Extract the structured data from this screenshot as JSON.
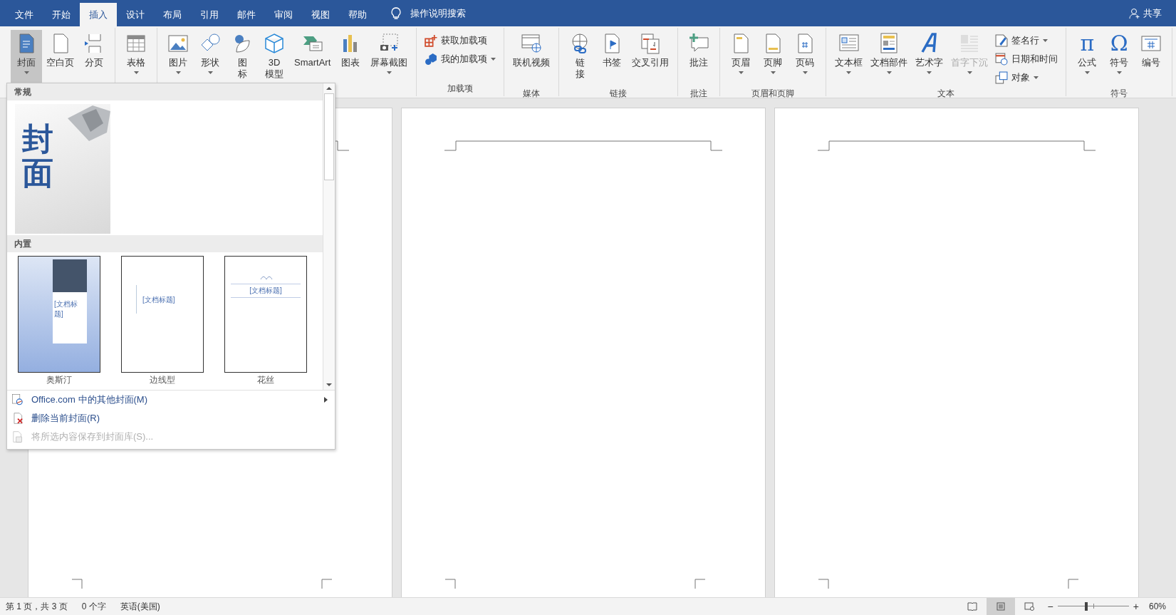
{
  "tabs": [
    {
      "label": "文件",
      "selected": false
    },
    {
      "label": "开始",
      "selected": false
    },
    {
      "label": "插入",
      "selected": true
    },
    {
      "label": "设计",
      "selected": false
    },
    {
      "label": "布局",
      "selected": false
    },
    {
      "label": "引用",
      "selected": false
    },
    {
      "label": "邮件",
      "selected": false
    },
    {
      "label": "审阅",
      "selected": false
    },
    {
      "label": "视图",
      "selected": false
    },
    {
      "label": "帮助",
      "selected": false
    }
  ],
  "search": {
    "label": "操作说明搜索"
  },
  "share": {
    "label": "共享"
  },
  "ribbon": {
    "groups": [
      {
        "items": [
          {
            "kind": "large",
            "label": "封面",
            "dropdown": true,
            "pressed": true,
            "disabled": false
          },
          {
            "kind": "large",
            "label": "空白页",
            "dropdown": false,
            "pressed": false,
            "disabled": false
          },
          {
            "kind": "large",
            "label": "分页",
            "dropdown": false,
            "pressed": false,
            "disabled": false
          }
        ]
      },
      {
        "items": [
          {
            "kind": "large",
            "label": "表格",
            "dropdown": true,
            "pressed": false,
            "disabled": false
          }
        ]
      },
      {
        "items": [
          {
            "kind": "large",
            "label": "图片",
            "dropdown": true,
            "pressed": false,
            "disabled": false
          },
          {
            "kind": "large",
            "label": "形状",
            "dropdown": true,
            "pressed": false,
            "disabled": false
          },
          {
            "kind": "large",
            "label_lines": [
              "图",
              "标"
            ],
            "dropdown": false,
            "pressed": false,
            "disabled": false
          },
          {
            "kind": "large",
            "label_lines": [
              "3D",
              "模型"
            ],
            "dropdown": false,
            "pressed": false,
            "disabled": false
          },
          {
            "kind": "large",
            "label": "SmartArt",
            "dropdown": false,
            "pressed": false,
            "disabled": false
          },
          {
            "kind": "large",
            "label": "图表",
            "dropdown": false,
            "pressed": false,
            "disabled": false
          },
          {
            "kind": "large",
            "label": "屏幕截图",
            "dropdown": true,
            "pressed": false,
            "disabled": false
          }
        ]
      },
      {
        "label": "加载项",
        "items": [
          {
            "kind": "small",
            "label": "获取加载项",
            "dropdown": false,
            "disabled": false
          },
          {
            "kind": "small",
            "label": "我的加载项",
            "dropdown": true,
            "disabled": false
          }
        ]
      },
      {
        "label": "媒体",
        "items": [
          {
            "kind": "large",
            "label": "联机视频",
            "dropdown": false,
            "pressed": false,
            "disabled": false
          }
        ]
      },
      {
        "label": "链接",
        "items": [
          {
            "kind": "large",
            "label_lines": [
              "链",
              "接"
            ],
            "dropdown": false,
            "pressed": false,
            "disabled": false
          },
          {
            "kind": "large",
            "label": "书签",
            "dropdown": false,
            "pressed": false,
            "disabled": false
          },
          {
            "kind": "large",
            "label": "交叉引用",
            "dropdown": false,
            "pressed": false,
            "disabled": false
          }
        ]
      },
      {
        "label": "批注",
        "items": [
          {
            "kind": "large",
            "label": "批注",
            "dropdown": false,
            "pressed": false,
            "disabled": false
          }
        ]
      },
      {
        "label": "页眉和页脚",
        "items": [
          {
            "kind": "large",
            "label": "页眉",
            "dropdown": true,
            "pressed": false,
            "disabled": false
          },
          {
            "kind": "large",
            "label": "页脚",
            "dropdown": true,
            "pressed": false,
            "disabled": false
          },
          {
            "kind": "large",
            "label": "页码",
            "dropdown": true,
            "pressed": false,
            "disabled": false
          }
        ]
      },
      {
        "label": "文本",
        "items": [
          {
            "kind": "large",
            "label": "文本框",
            "dropdown": true,
            "pressed": false,
            "disabled": false
          },
          {
            "kind": "large",
            "label": "文档部件",
            "dropdown": true,
            "pressed": false,
            "disabled": false
          },
          {
            "kind": "large",
            "label": "艺术字",
            "dropdown": true,
            "pressed": false,
            "disabled": false
          },
          {
            "kind": "large",
            "label": "首字下沉",
            "dropdown": true,
            "pressed": false,
            "disabled": true
          },
          {
            "kind": "small",
            "label": "签名行",
            "dropdown": true,
            "disabled": false
          },
          {
            "kind": "small",
            "label": "日期和时间",
            "dropdown": false,
            "disabled": false
          },
          {
            "kind": "small",
            "label": "对象",
            "dropdown": true,
            "disabled": false
          }
        ]
      },
      {
        "label": "符号",
        "items": [
          {
            "kind": "large",
            "label": "公式",
            "glyph": "π",
            "dropdown": true,
            "pressed": false,
            "disabled": false
          },
          {
            "kind": "large",
            "label": "符号",
            "glyph": "Ω",
            "dropdown": true,
            "pressed": false,
            "disabled": false
          },
          {
            "kind": "large",
            "label": "编号",
            "dropdown": false,
            "pressed": false,
            "disabled": false
          }
        ]
      }
    ]
  },
  "cover_menu": {
    "sections": [
      {
        "title": "常规",
        "thumbs": [
          {
            "kind": "custom",
            "title": "封面"
          }
        ]
      },
      {
        "title": "内置",
        "thumbs": [
          {
            "kind": "austin",
            "title": "[文档标题]",
            "label": "奥斯汀"
          },
          {
            "kind": "sideline",
            "title": "[文档标题]",
            "label": "边线型"
          },
          {
            "kind": "filigree",
            "title": "[文档标题]",
            "label": "花丝"
          }
        ]
      }
    ],
    "commands": [
      {
        "label": "Office.com 中的其他封面(M)",
        "submenu": true,
        "disabled": false
      },
      {
        "label": "删除当前封面(R)",
        "submenu": false,
        "disabled": false
      },
      {
        "label": "将所选内容保存到封面库(S)...",
        "submenu": false,
        "disabled": true
      }
    ]
  },
  "status_bar": {
    "items": [
      "第 1 页，共 3 页",
      "0 个字",
      "英语(美国)"
    ],
    "views": [
      {
        "selected": false
      },
      {
        "selected": true
      },
      {
        "selected": false
      }
    ],
    "zoom": {
      "minus": "−",
      "plus": "+",
      "level": 0.4,
      "reading": "60%"
    }
  }
}
